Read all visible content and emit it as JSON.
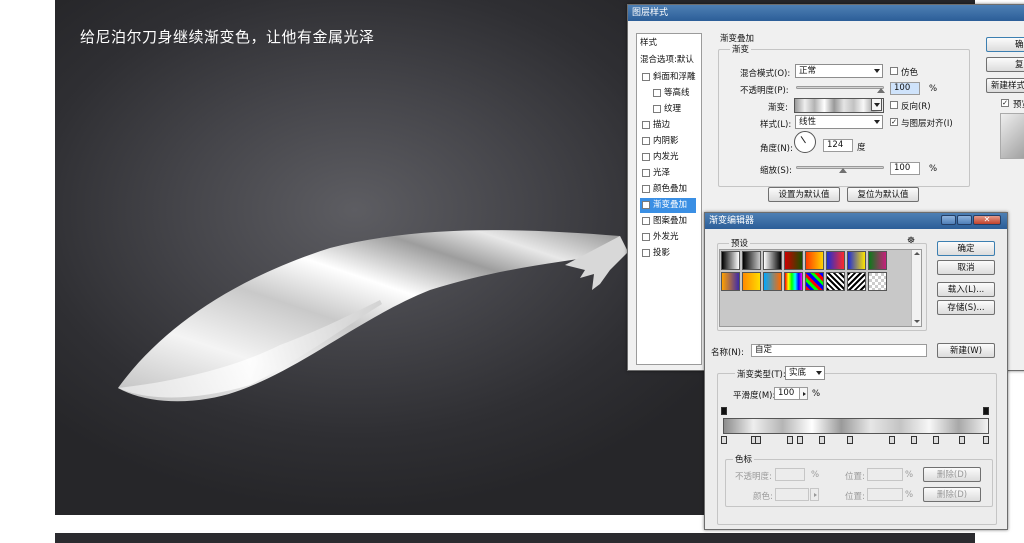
{
  "caption": "给尼泊尔刀身继续渐变色，让他有金属光泽",
  "layer_style": {
    "title": "图层样式",
    "side_header": "样式",
    "side_blend": "混合选项:默认",
    "side_items": [
      {
        "label": "斜面和浮雕",
        "checked": false
      },
      {
        "label": "等高线",
        "checked": false
      },
      {
        "label": "纹理",
        "checked": false
      },
      {
        "label": "描边",
        "checked": false
      },
      {
        "label": "内阴影",
        "checked": false
      },
      {
        "label": "内发光",
        "checked": false
      },
      {
        "label": "光泽",
        "checked": false
      },
      {
        "label": "颜色叠加",
        "checked": false
      },
      {
        "label": "渐变叠加",
        "checked": true,
        "selected": true
      },
      {
        "label": "图案叠加",
        "checked": false
      },
      {
        "label": "外发光",
        "checked": false
      },
      {
        "label": "投影",
        "checked": false
      }
    ],
    "section_title": "渐变叠加",
    "group_title": "渐变",
    "blend_mode_label": "混合模式(O):",
    "blend_mode_value": "正常",
    "dither_label": "仿色",
    "opacity_label": "不透明度(P):",
    "opacity_value": "100",
    "opacity_unit": "%",
    "gradient_label": "渐变:",
    "reverse_label": "反向(R)",
    "style_label": "样式(L):",
    "style_value": "线性",
    "align_label": "与图层对齐(I)",
    "angle_label": "角度(N):",
    "angle_value": "124",
    "angle_unit": "度",
    "scale_label": "缩放(S):",
    "scale_value": "100",
    "scale_unit": "%",
    "set_default_button": "设置为默认值",
    "reset_default_button": "复位为默认值",
    "right_buttons": [
      "确",
      "复",
      "新建样式"
    ],
    "preview_label": "预览"
  },
  "gradient_editor": {
    "title": "渐变编辑器",
    "presets_label": "预设",
    "ok_button": "确定",
    "cancel_button": "取消",
    "load_button": "载入(L)...",
    "save_button": "存储(S)...",
    "name_label": "名称(N):",
    "name_value": "自定",
    "new_button": "新建(W)",
    "type_label": "渐变类型(T):",
    "type_value": "实底",
    "smooth_label": "平滑度(M):",
    "smooth_value": "100",
    "smooth_unit": "%",
    "color_stops_label": "色标",
    "opacity_label": "不透明度:",
    "opacity_unit": "%",
    "location_label": "位置:",
    "location_unit": "%",
    "delete_button": "删除(D)",
    "color_label": "颜色:",
    "location2_label": "位置:",
    "location2_unit": "%",
    "delete2_button": "删除(D)",
    "gradient_bar": [
      "#8c8c8c",
      "#eeeeee",
      "#b5b5b5",
      "#ffffff",
      "#9a9a9a",
      "#e6e6e6",
      "#c4c4c4",
      "#f7f7f7",
      "#a8a8a8",
      "#f2f2f2"
    ]
  }
}
